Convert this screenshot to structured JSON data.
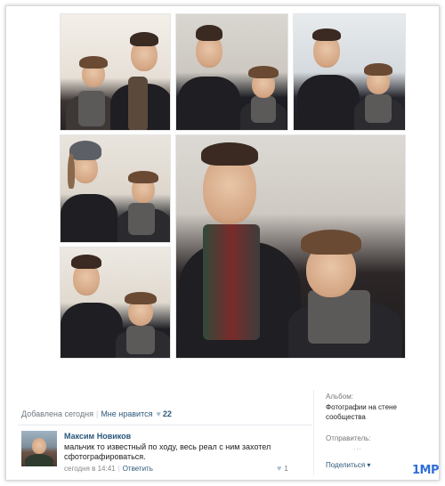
{
  "post": {
    "date_label": "Добавлена сегодня",
    "like_label": "Мне нравится",
    "like_count": "22"
  },
  "comment": {
    "author": "Максим Новиков",
    "text": "мальчик то известный по ходу, весь реал с ним захотел сфотографироваться.",
    "time": "сегодня в 14:41",
    "reply": "Ответить",
    "likes": "1"
  },
  "sidebar": {
    "album_label": "Альбом:",
    "album_value": "Фотографии на стене сообщества",
    "sender_label": "Отправитель:",
    "sender_value": "...",
    "share_label": "Поделиться"
  },
  "watermark": "1MP",
  "colors": {
    "link": "#2b587a",
    "muted": "#6d7883",
    "heart": "#a8bed2",
    "watermark": "#2f6fd6"
  },
  "icons": {
    "like": "heart-icon",
    "share_caret": "chevron-down-icon"
  }
}
